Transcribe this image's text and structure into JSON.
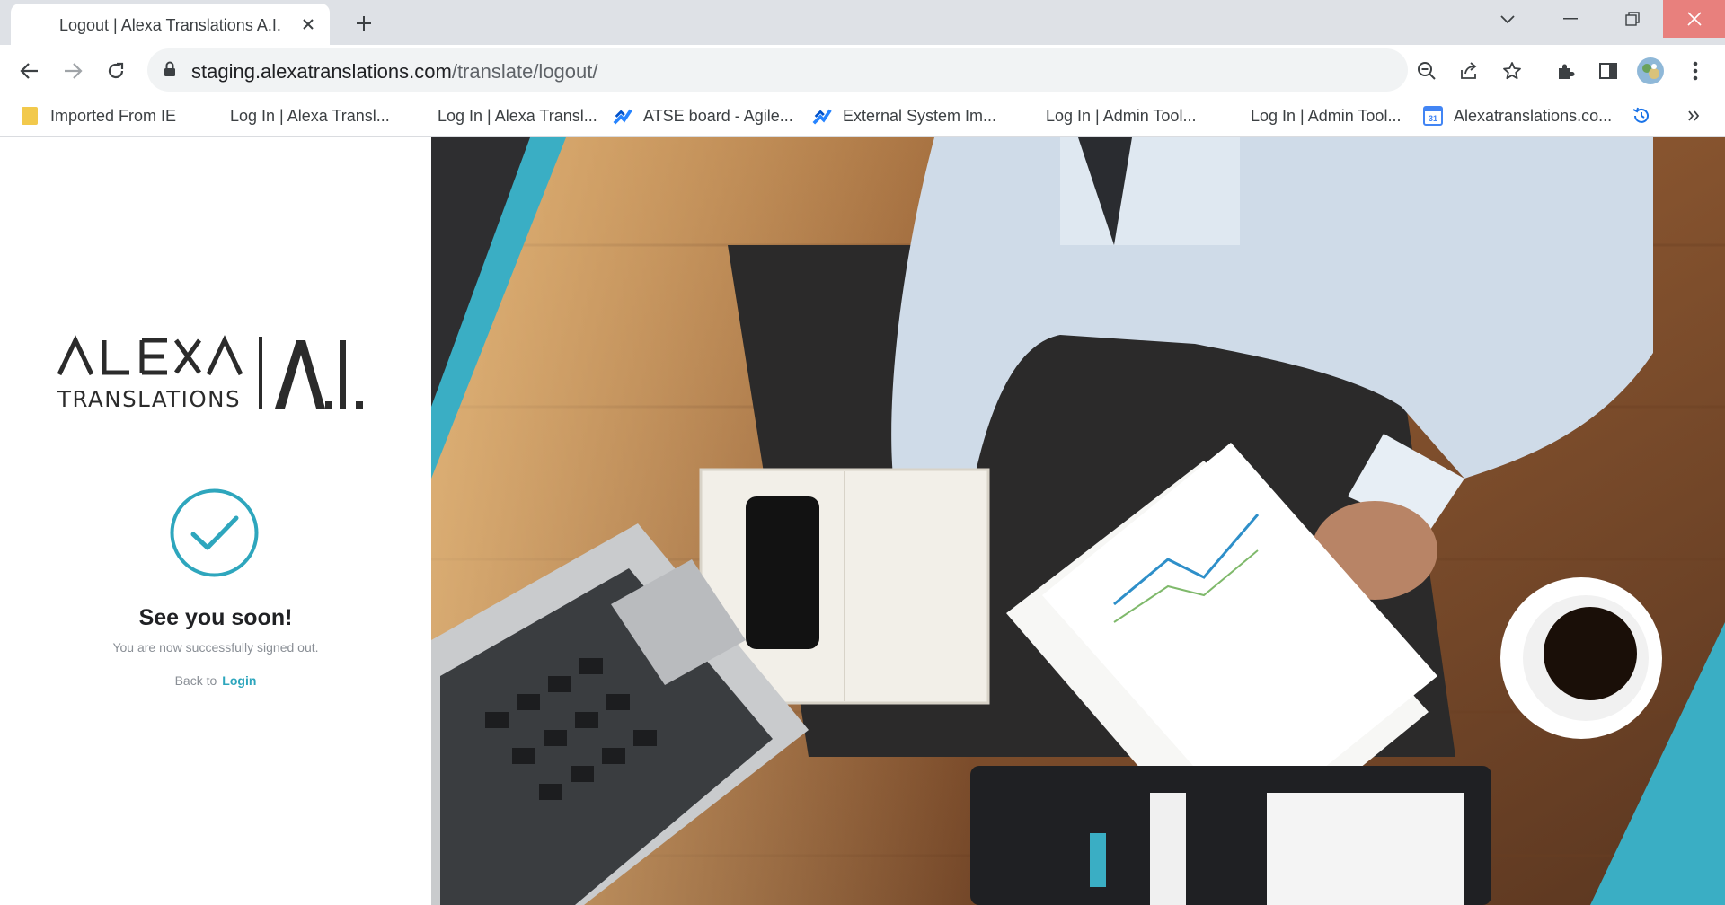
{
  "browser": {
    "tab_title": "Logout | Alexa Translations A.I.",
    "url_host": "staging.alexatranslations.com",
    "url_path": "/translate/logout/"
  },
  "bookmarks": [
    {
      "label": "Imported From IE",
      "icon": "folder-icon"
    },
    {
      "label": "Log In | Alexa Transl...",
      "icon": "none"
    },
    {
      "label": "Log In | Alexa Transl...",
      "icon": "none"
    },
    {
      "label": "ATSE board - Agile...",
      "icon": "jira-icon"
    },
    {
      "label": "External System Im...",
      "icon": "jira-icon"
    },
    {
      "label": "Log In | Admin Tool...",
      "icon": "none"
    },
    {
      "label": "Log In | Admin Tool...",
      "icon": "none"
    },
    {
      "label": "Alexatranslations.co...",
      "icon": "calendar-icon"
    }
  ],
  "logo": {
    "word": "ALEXA",
    "sub": "TRANSLATIONS",
    "ai": "A.I."
  },
  "logout": {
    "heading": "See you soon!",
    "message": "You are now successfully signed out.",
    "back_text": "Back to",
    "login_link": "Login"
  },
  "colors": {
    "accent": "#2ea6bd",
    "tabstrip": "#dee1e6",
    "close_hover": "#e8807d"
  }
}
